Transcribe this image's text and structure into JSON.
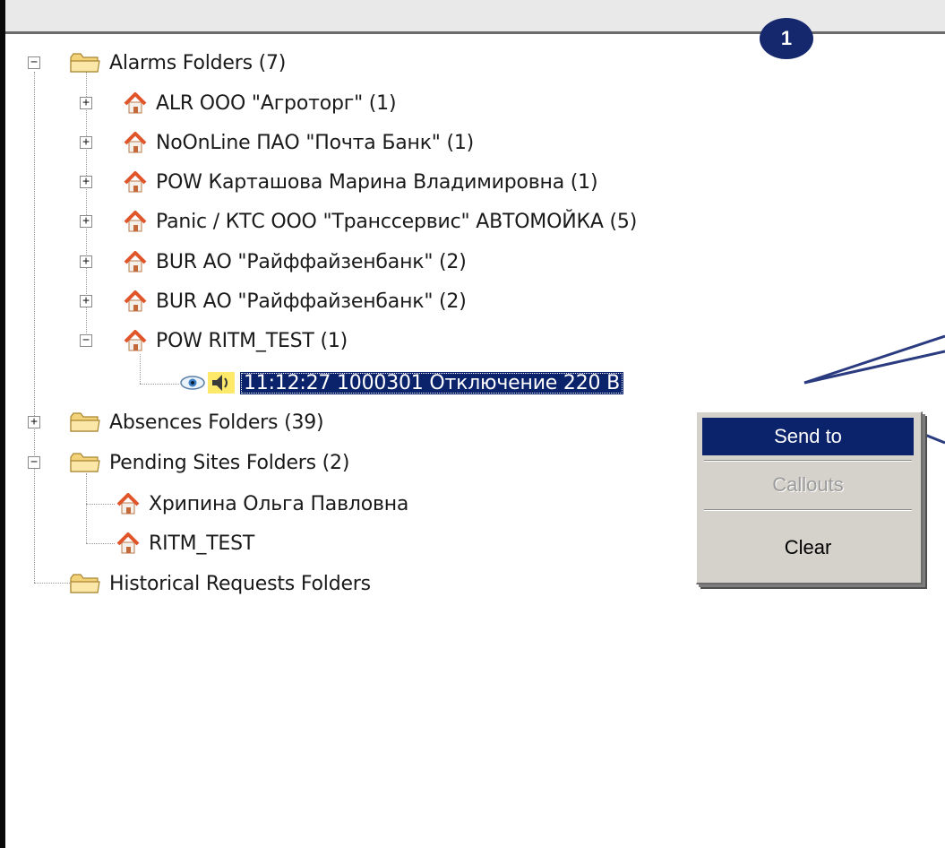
{
  "badge": {
    "number": "1"
  },
  "tree": {
    "alarms": {
      "label": "Alarms Folders (7)",
      "children": [
        "ALR ООО \"Агроторг\" (1)",
        "NoOnLine ПАО \"Почта Банк\" (1)",
        "POW Карташова Марина Владимировна (1)",
        "Panic / КТС ООО \"Транссервис\" АВТОМОЙКА (5)",
        "BUR АО \"Райффайзенбанк\" (2)",
        "BUR АО \"Райффайзенбанк\" (2)",
        "POW RITM_TEST (1)"
      ],
      "selected_event": "11:12:27 1000301 Отключение 220 В"
    },
    "absences": {
      "label": "Absences Folders (39)"
    },
    "pending": {
      "label": "Pending Sites Folders (2)",
      "children": [
        "Хрипина Ольга Павловна",
        "RITM_TEST"
      ]
    },
    "historical": {
      "label": "Historical Requests Folders"
    }
  },
  "context_menu": {
    "items": [
      {
        "label": "Send to",
        "state": "highlighted"
      },
      {
        "label": "Callouts",
        "state": "disabled"
      },
      {
        "label": "Clear",
        "state": "normal"
      }
    ]
  },
  "colors": {
    "selection": "#0b236b",
    "folder": "#f2d37a",
    "house_roof": "#e0552a",
    "badge": "#16286d",
    "callout_line": "#2a3b80"
  },
  "icons": {
    "folder": "folder-icon",
    "house": "house-icon",
    "eye": "eye-icon",
    "speaker": "speaker-icon"
  }
}
